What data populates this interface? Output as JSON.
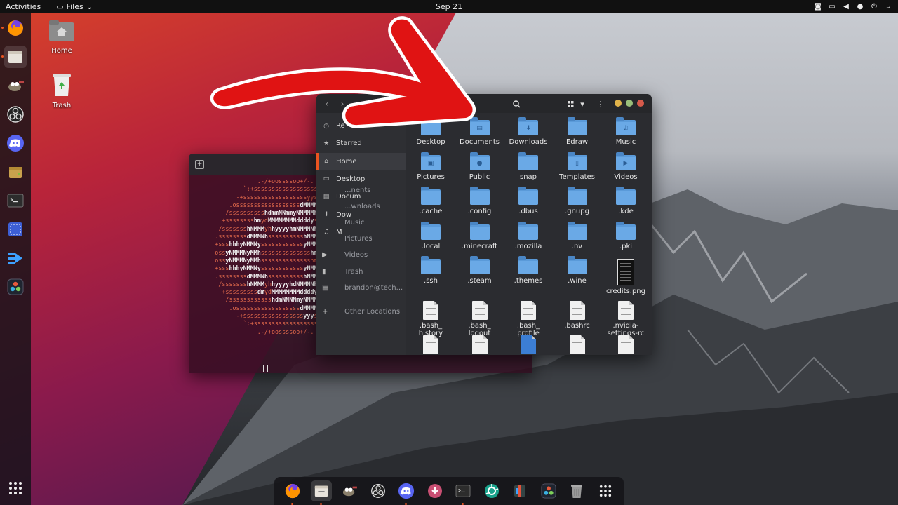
{
  "topbar": {
    "activities": "Activities",
    "app_menu": "Files",
    "clock": "Sep 21"
  },
  "desktop": {
    "home_label": "Home",
    "trash_label": "Trash"
  },
  "files": {
    "sidebar": [
      {
        "label": "Re",
        "icon": "recent-icon"
      },
      {
        "label": "Starred",
        "icon": "star-icon"
      },
      {
        "label": "Home",
        "icon": "home-icon"
      },
      {
        "label": "Desktop",
        "icon": "desktop-icon"
      },
      {
        "label": "Docum",
        "icon": "document-icon"
      },
      {
        "label": "Dow",
        "icon": "download-icon"
      },
      {
        "label": "M",
        "icon": "music-icon"
      }
    ],
    "sidebar_ghost": [
      "...nents",
      "...wnloads",
      "Music",
      "Pictures",
      "Videos",
      "Trash",
      "brandon@tech...",
      "Other Locations"
    ],
    "items": [
      {
        "name": "Desktop",
        "type": "folder",
        "glyph": ""
      },
      {
        "name": "Documents",
        "type": "folder",
        "glyph": "▤"
      },
      {
        "name": "Downloads",
        "type": "folder",
        "glyph": "⬇"
      },
      {
        "name": "Edraw",
        "type": "folder",
        "glyph": ""
      },
      {
        "name": "Music",
        "type": "folder",
        "glyph": "♫"
      },
      {
        "name": "Pictures",
        "type": "folder",
        "glyph": "▣"
      },
      {
        "name": "Public",
        "type": "folder",
        "glyph": "●"
      },
      {
        "name": "snap",
        "type": "folder",
        "glyph": ""
      },
      {
        "name": "Templates",
        "type": "folder",
        "glyph": "▯"
      },
      {
        "name": "Videos",
        "type": "folder",
        "glyph": "▶"
      },
      {
        "name": ".cache",
        "type": "folder",
        "glyph": ""
      },
      {
        "name": ".config",
        "type": "folder",
        "glyph": ""
      },
      {
        "name": ".dbus",
        "type": "folder",
        "glyph": ""
      },
      {
        "name": ".gnupg",
        "type": "folder",
        "glyph": ""
      },
      {
        "name": ".kde",
        "type": "folder",
        "glyph": ""
      },
      {
        "name": ".local",
        "type": "folder",
        "glyph": ""
      },
      {
        "name": ".minecraft",
        "type": "folder",
        "glyph": ""
      },
      {
        "name": ".mozilla",
        "type": "folder",
        "glyph": ""
      },
      {
        "name": ".nv",
        "type": "folder",
        "glyph": ""
      },
      {
        "name": ".pki",
        "type": "folder",
        "glyph": ""
      },
      {
        "name": ".ssh",
        "type": "folder",
        "glyph": ""
      },
      {
        "name": ".steam",
        "type": "folder",
        "glyph": ""
      },
      {
        "name": ".themes",
        "type": "folder",
        "glyph": ""
      },
      {
        "name": ".wine",
        "type": "folder",
        "glyph": ""
      },
      {
        "name": "credits.png",
        "type": "image",
        "glyph": ""
      },
      {
        "name": ".bash_\nhistory",
        "type": "file",
        "glyph": ""
      },
      {
        "name": ".bash_\nlogout",
        "type": "file",
        "glyph": ""
      },
      {
        "name": ".bash_\nprofile",
        "type": "file",
        "glyph": ""
      },
      {
        "name": ".bashrc",
        "type": "file",
        "glyph": ""
      },
      {
        "name": ".nvidia-\nsettings-rc",
        "type": "file",
        "glyph": ""
      },
      {
        "name": "",
        "type": "file",
        "glyph": ""
      },
      {
        "name": "",
        "type": "file",
        "glyph": ""
      },
      {
        "name": "",
        "type": "link",
        "glyph": ""
      },
      {
        "name": "",
        "type": "file",
        "glyph": ""
      },
      {
        "name": "",
        "type": "file",
        "glyph": ""
      }
    ]
  },
  "terminal": {
    "lines": [
      "                   .-/+oossssoo+/-.",
      "               `:+ssssssssssssssssss+:`",
      "             -+ssssssssssssssssssyyssss+-",
      "           .ossssssssssssssssss|dMMMNy|sssso.",
      "          /ssssssssss|hdmmNNmmyNMMMMh|ssssss/",
      "         +ssssssss|hm|yd|MMMMMMMNddddy|ssssssss+",
      "        /sssssss|hNMMM|yh|hyyyyhmNMMMNh|ssssssss/",
      "       .ssssssss|dMMMNh|ssssssssss|hNMMMd|ssssssss.",
      "       +sss|hhhyNMMNy|ssssssssssss|yNMMMy|sssssss+",
      "       oss|yNMMMNyMMh|ssssssssssssss|hmmmh|ssssssso",
      "       oss|yNMMMNyMMh|sssssssssssssshmmmh|ssssssso",
      "       +sss|hhhyNMMNy|ssssssssssss|yNMMMy|sssssss+",
      "       .ssssssss|dMMMNh|ssssssssss|hNMMMd|ssssssss.",
      "        /sssssss|hNMMM|yh|hyyyyhdNMMMNh|ssssssss/",
      "         +sssssssss|dm|yd|MMMMMMMMddddy|ssssssss+",
      "          /ssssssssssss|hdmNNNNmyNMMMMh|ssssss/",
      "           .ossssssssssssssssss|dMMMNy|sssso.",
      "             -+sssssssssssssssss|yyy|ssss+-",
      "               `:+ssssssssssssssssss+:`",
      "                   .-/+oossssoo+/-."
    ]
  },
  "dock": {
    "left_apps": [
      "firefox-icon",
      "files-icon",
      "gimp-icon",
      "obs-icon",
      "discord-icon",
      "archive-icon",
      "terminal-icon",
      "screenshot-icon",
      "resolve-icon",
      "davinci-icon",
      "app-grid-icon"
    ],
    "bottom_apps": [
      "firefox-icon",
      "files-icon",
      "gimp-icon",
      "obs-icon",
      "discord-icon",
      "installer-icon",
      "terminal-icon",
      "aperture-icon",
      "kdenlive-icon",
      "davinci-icon",
      "trash-icon",
      "app-grid-icon"
    ]
  },
  "colors": {
    "accent": "#e95420",
    "folder": "#5a9ad9",
    "arrow": "#e01313"
  }
}
